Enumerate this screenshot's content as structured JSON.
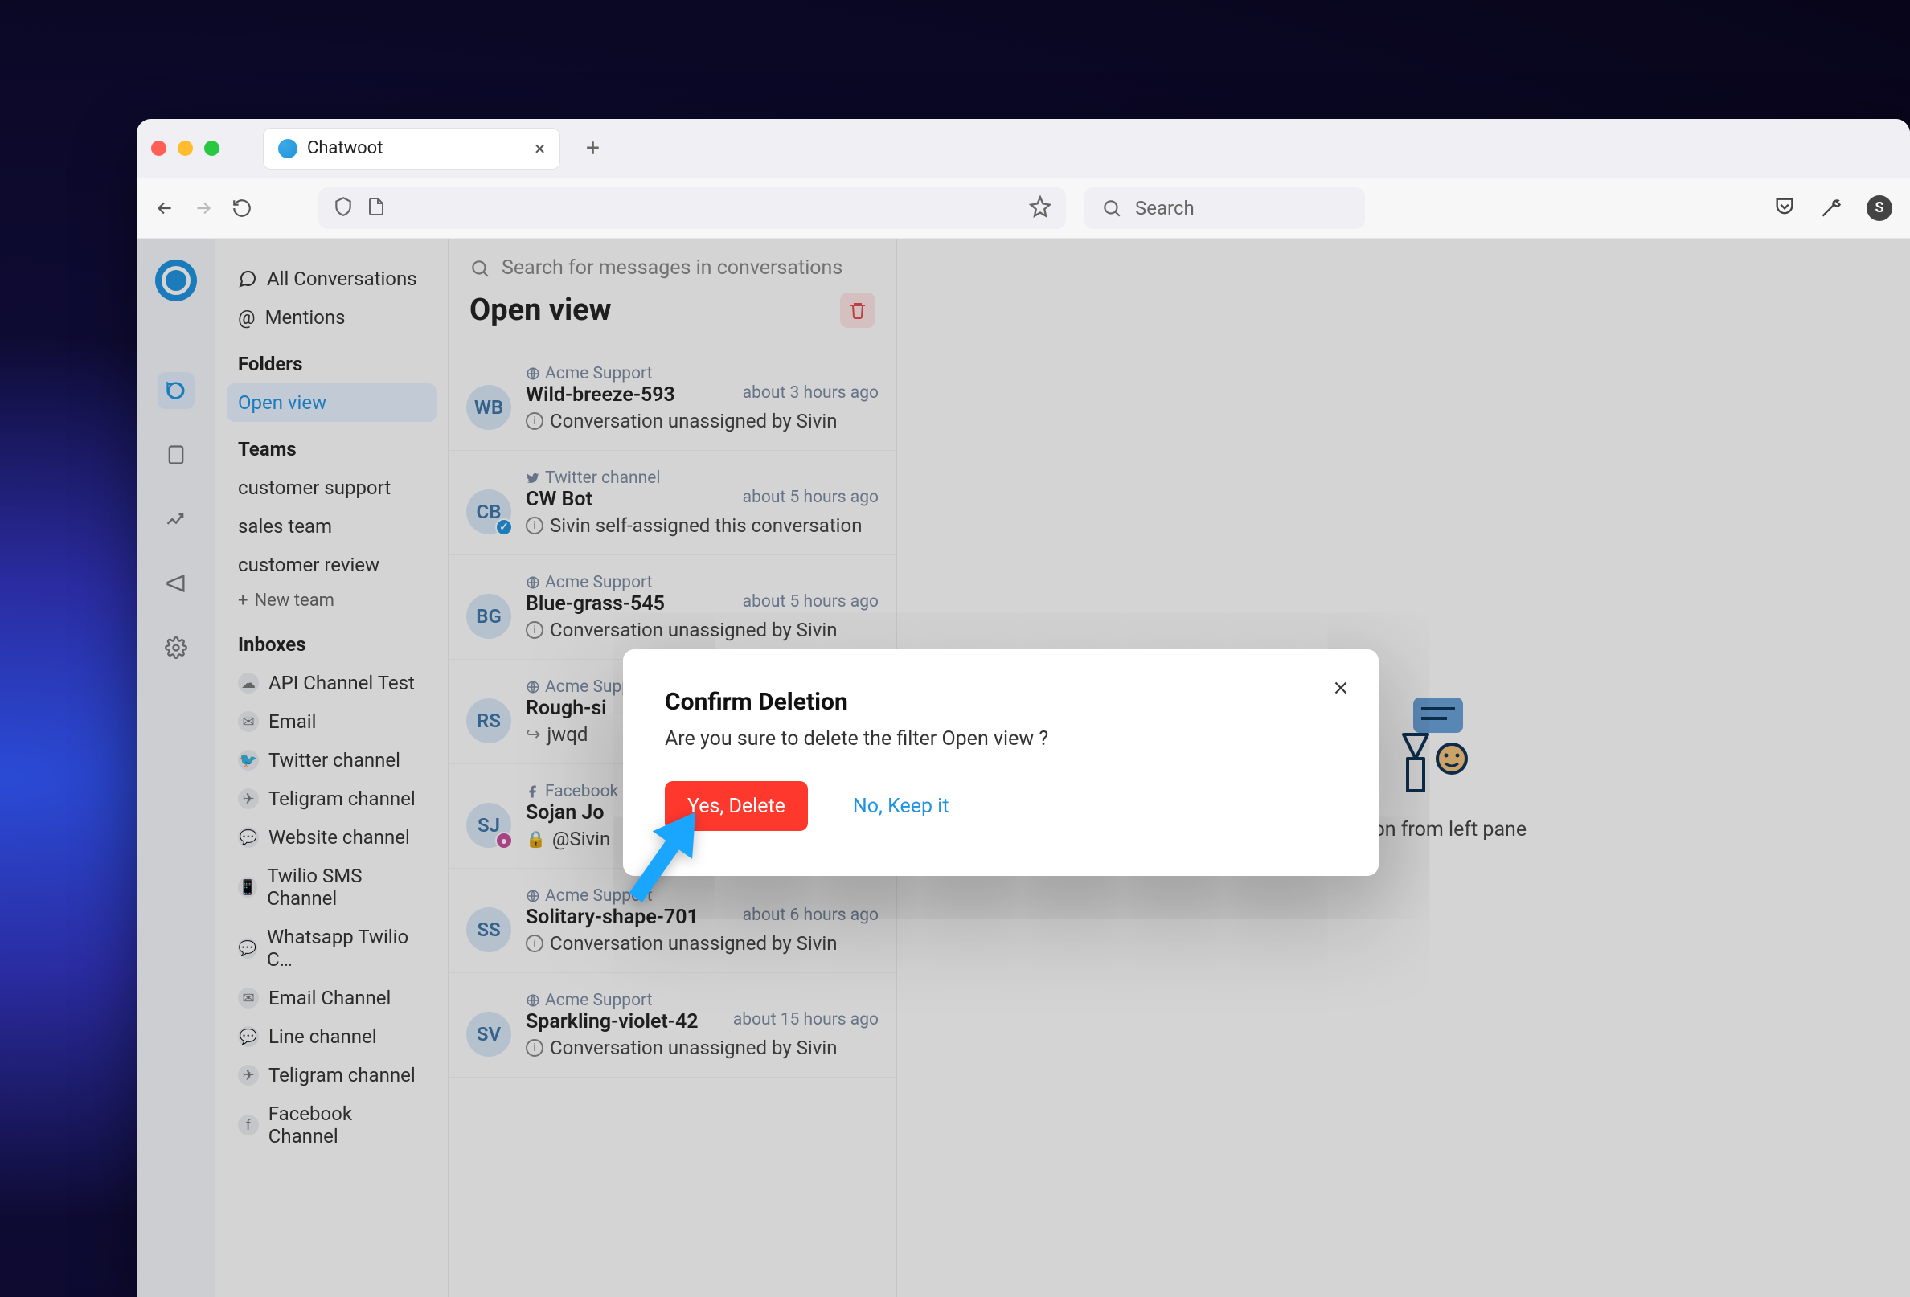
{
  "browser": {
    "tab_title": "Chatwoot",
    "search_placeholder": "Search",
    "avatar_letter": "S"
  },
  "sidebar": {
    "all_conversations": "All Conversations",
    "mentions": "Mentions",
    "folders_heading": "Folders",
    "folders": [
      "Open view"
    ],
    "teams_heading": "Teams",
    "teams": [
      "customer support",
      "sales team",
      "customer review"
    ],
    "new_team": "New team",
    "inboxes_heading": "Inboxes",
    "inboxes": [
      "API Channel Test",
      "Email",
      "Twitter channel",
      "Teligram channel",
      "Website channel",
      "Twilio SMS Channel",
      "Whatsapp Twilio C…",
      "Email Channel",
      "Line channel",
      "Teligram channel",
      "Facebook Channel"
    ]
  },
  "mid": {
    "search_placeholder": "Search for messages in conversations",
    "title": "Open view"
  },
  "conversations": [
    {
      "initials": "WB",
      "inbox": "Acme Support",
      "inbox_icon": "globe",
      "name": "Wild-breeze-593",
      "time": "about 3 hours ago",
      "msg": "Conversation unassigned by Sivin",
      "badge": ""
    },
    {
      "initials": "CB",
      "inbox": "Twitter channel",
      "inbox_icon": "twitter",
      "name": "CW Bot",
      "time": "about 5 hours ago",
      "msg": "Sivin self-assigned this conversation",
      "badge": "blue"
    },
    {
      "initials": "BG",
      "inbox": "Acme Support",
      "inbox_icon": "globe",
      "name": "Blue-grass-545",
      "time": "about 5 hours ago",
      "msg": "Conversation unassigned by Sivin",
      "badge": ""
    },
    {
      "initials": "RS",
      "inbox": "Acme Support",
      "inbox_icon": "globe",
      "name": "Rough-si",
      "time": "",
      "msg": "jwqd",
      "badge": "",
      "reply": true
    },
    {
      "initials": "SJ",
      "inbox": "Facebook",
      "inbox_icon": "facebook",
      "name": "Sojan Jo",
      "time": "",
      "msg": "@Sivin",
      "badge": "pink",
      "lock": true
    },
    {
      "initials": "SS",
      "inbox": "Acme Support",
      "inbox_icon": "globe",
      "name": "Solitary-shape-701",
      "time": "about 6 hours ago",
      "msg": "Conversation unassigned by Sivin",
      "badge": ""
    },
    {
      "initials": "SV",
      "inbox": "Acme Support",
      "inbox_icon": "globe",
      "name": "Sparkling-violet-42",
      "time": "about 15 hours ago",
      "msg": "Conversation unassigned by Sivin",
      "badge": ""
    }
  ],
  "main": {
    "placeholder": "conversation from left pane"
  },
  "modal": {
    "title": "Confirm Deletion",
    "body": "Are you sure to delete the filter Open view ?",
    "confirm": "Yes, Delete",
    "cancel": "No, Keep it"
  }
}
